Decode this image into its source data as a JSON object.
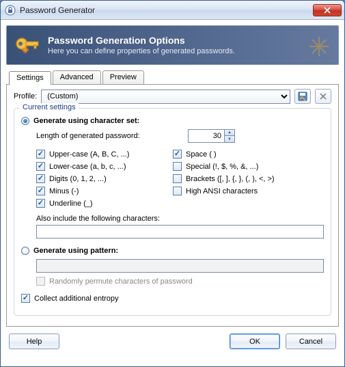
{
  "window": {
    "title": "Password Generator"
  },
  "header": {
    "title": "Password Generation Options",
    "subtitle": "Here you can define properties of generated passwords."
  },
  "tabs": [
    {
      "label": "Settings",
      "active": true
    },
    {
      "label": "Advanced",
      "active": false
    },
    {
      "label": "Preview",
      "active": false
    }
  ],
  "profile": {
    "label": "Profile:",
    "value": "(Custom)"
  },
  "fieldset": {
    "legend": "Current settings"
  },
  "charset": {
    "radio_label": "Generate using character set:",
    "selected": true,
    "length_label": "Length of generated password:",
    "length_value": "30",
    "options_left": [
      {
        "label": "Upper-case (A, B, C, ...)",
        "checked": true
      },
      {
        "label": "Lower-case (a, b, c, ...)",
        "checked": true
      },
      {
        "label": "Digits (0, 1, 2, ...)",
        "checked": true
      },
      {
        "label": "Minus (-)",
        "checked": true
      },
      {
        "label": "Underline (_)",
        "checked": true
      }
    ],
    "options_right": [
      {
        "label": "Space ( )",
        "checked": true
      },
      {
        "label": "Special (!, $, %, &, ...)",
        "checked": false
      },
      {
        "label": "Brackets ([, ], {, }, (, ), <, >)",
        "checked": false
      },
      {
        "label": "High ANSI characters",
        "checked": false
      }
    ],
    "also_label": "Also include the following characters:",
    "also_value": ""
  },
  "pattern": {
    "radio_label": "Generate using pattern:",
    "selected": false,
    "pattern_value": "",
    "permute_label": "Randomly permute characters of password",
    "permute_checked": false
  },
  "entropy": {
    "label": "Collect additional entropy",
    "checked": true
  },
  "buttons": {
    "help": "Help",
    "ok": "OK",
    "cancel": "Cancel"
  }
}
